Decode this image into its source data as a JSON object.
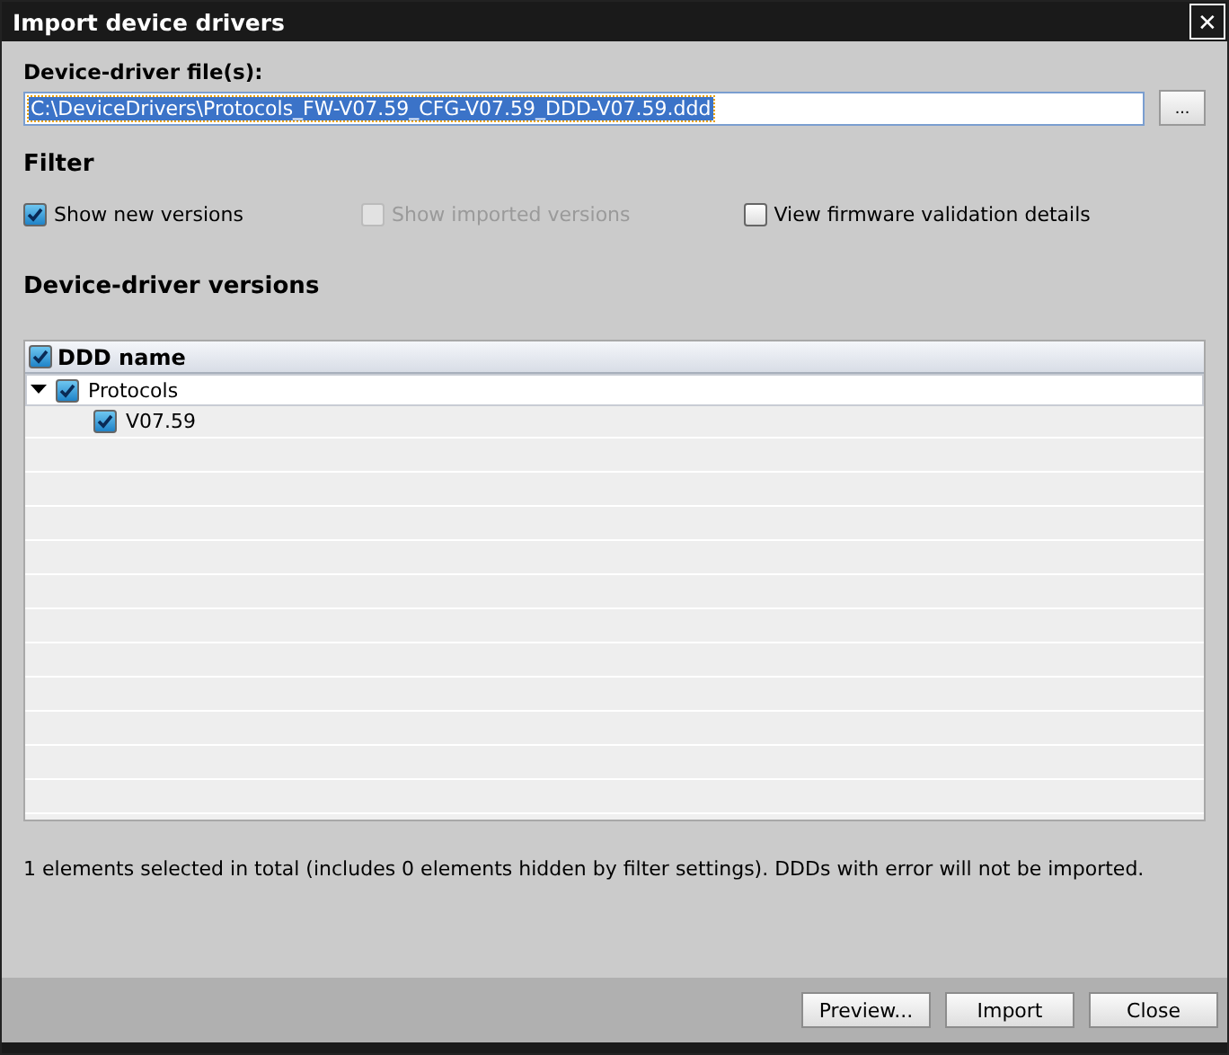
{
  "window": {
    "title": "Import device drivers",
    "close": "✕"
  },
  "file_field": {
    "label": "Device-driver file(s):",
    "value": "C:\\DeviceDrivers\\Protocols_FW-V07.59_CFG-V07.59_DDD-V07.59.ddd",
    "text_selected": true,
    "browse": "..."
  },
  "filter": {
    "title": "Filter",
    "options": [
      {
        "label": "Show new versions",
        "checked": true,
        "disabled": false
      },
      {
        "label": "Show imported versions",
        "checked": false,
        "disabled": true
      },
      {
        "label": "View firmware validation details",
        "checked": false,
        "disabled": false
      }
    ]
  },
  "versions": {
    "title": "Device-driver versions",
    "header": {
      "label": "DDD name",
      "checked": true
    },
    "rows": [
      {
        "label": "Protocols",
        "checked": true,
        "expanded": true,
        "children": [
          {
            "label": "V07.59",
            "checked": true
          }
        ]
      }
    ]
  },
  "summary": "1 elements selected in total (includes 0 elements hidden by filter settings). DDDs with error will not be imported.",
  "buttons": [
    "Preview...",
    "Import",
    "Close"
  ]
}
